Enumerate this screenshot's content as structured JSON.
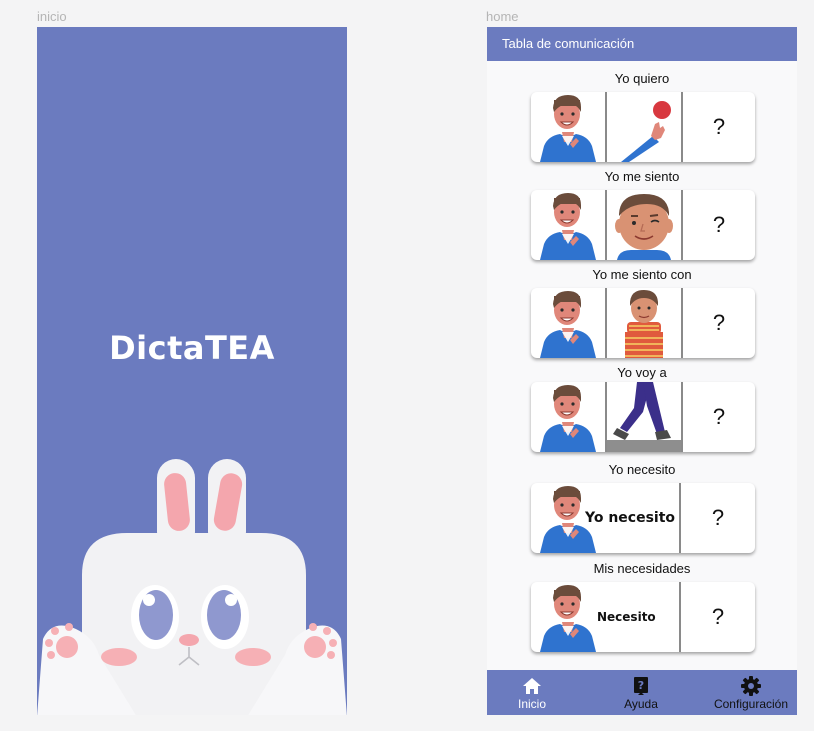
{
  "frames": {
    "splash_label": "inicio",
    "home_label": "home"
  },
  "splash": {
    "title": "DictaTEA",
    "colors": {
      "background": "#6b7bbf",
      "bunny": "#f2f2f4",
      "ear_inner": "#f4a6ad",
      "eyes": "#8f98cf"
    }
  },
  "home": {
    "header_title": "Tabla de comunicación",
    "sections": [
      {
        "title": "Yo quiero",
        "slot2": "boy-with-ball-icon",
        "slot3": "?"
      },
      {
        "title": "Yo me siento",
        "slot2": "boy-face-icon",
        "slot3": "?"
      },
      {
        "title": "Yo me siento con",
        "slot2": "boy-with-scarf-icon",
        "slot3": "?"
      },
      {
        "title": "Yo voy a",
        "slot2": "walking-legs-icon",
        "slot3": "?"
      },
      {
        "title": "Yo necesito",
        "phrase": "Yo necesito",
        "slot3": "?"
      },
      {
        "title": "Mis necesidades",
        "phrase": "Necesito",
        "slot3": "?"
      }
    ],
    "nav": [
      {
        "label": "Inicio",
        "icon": "home-icon"
      },
      {
        "label": "Ayuda",
        "icon": "help-icon"
      },
      {
        "label": "Configuración",
        "icon": "gear-icon"
      }
    ],
    "colors": {
      "header": "#6b7bbf",
      "nav": "#6b7bbf",
      "active_nav_text": "#ffffff"
    }
  }
}
